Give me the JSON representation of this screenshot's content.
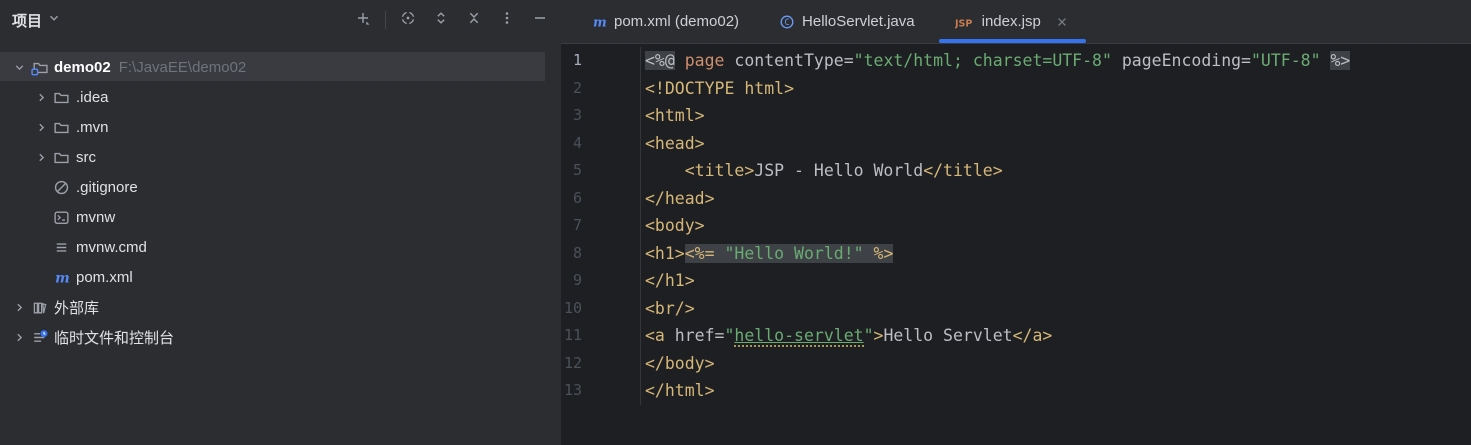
{
  "colors": {
    "accent": "#3574f0",
    "editor_bg": "#1e1f22",
    "panel_bg": "#2b2d30",
    "selection_bg": "#393b40",
    "tag": "#d5b778",
    "keyword": "#cf8e6d",
    "string": "#6aab73",
    "plain_text": "#bcbec4",
    "maven_blue": "#548af7",
    "jsp_orange": "#c77d4f"
  },
  "project_panel": {
    "title": "项目",
    "title_chevron_icon": "chevron-down-icon",
    "toolbar": [
      {
        "id": "add",
        "icon": "plus-icon"
      },
      {
        "id": "divider"
      },
      {
        "id": "locate",
        "icon": "target-icon"
      },
      {
        "id": "expand-all",
        "icon": "expand-icon"
      },
      {
        "id": "collapse-all",
        "icon": "collapse-icon"
      },
      {
        "id": "more",
        "icon": "kebab-icon"
      },
      {
        "id": "hide",
        "icon": "minimize-icon"
      }
    ],
    "tree": [
      {
        "label": "demo02",
        "path": "F:\\JavaEE\\demo02",
        "icon": "project-folder-icon",
        "chevron": "down",
        "level": 0,
        "selected": true,
        "bold": true
      },
      {
        "label": ".idea",
        "icon": "folder-icon",
        "chevron": "right",
        "level": 1
      },
      {
        "label": ".mvn",
        "icon": "folder-icon",
        "chevron": "right",
        "level": 1
      },
      {
        "label": "src",
        "icon": "folder-icon",
        "chevron": "right",
        "level": 1
      },
      {
        "label": ".gitignore",
        "icon": "ignored-file-icon",
        "level": 1
      },
      {
        "label": "mvnw",
        "icon": "shell-file-icon",
        "level": 1
      },
      {
        "label": "mvnw.cmd",
        "icon": "text-file-icon",
        "level": 1
      },
      {
        "label": "pom.xml",
        "icon": "maven-icon",
        "level": 1
      },
      {
        "label": "外部库",
        "icon": "library-icon",
        "chevron": "right",
        "level": 0
      },
      {
        "label": "临时文件和控制台",
        "icon": "scratch-icon",
        "chevron": "right",
        "level": 0
      }
    ]
  },
  "editor": {
    "tabs": [
      {
        "label": "pom.xml (demo02)",
        "icon": "maven-icon",
        "active": false,
        "closable": false
      },
      {
        "label": "HelloServlet.java",
        "icon": "java-class-icon",
        "active": false,
        "closable": false
      },
      {
        "label": "index.jsp",
        "icon": "jsp-icon",
        "active": true,
        "closable": true
      }
    ],
    "close_icon": "close-icon",
    "current_line": 1,
    "code_lines": [
      {
        "num": 1,
        "segments": [
          {
            "c": "caret",
            "t": ""
          },
          {
            "c": "txt jspbg",
            "t": "<%@"
          },
          {
            "c": "txt",
            "t": " "
          },
          {
            "c": "kw",
            "t": "page"
          },
          {
            "c": "txt",
            "t": " contentType="
          },
          {
            "c": "str",
            "t": "\"text/html; charset=UTF-8\""
          },
          {
            "c": "txt",
            "t": " pageEncoding="
          },
          {
            "c": "str",
            "t": "\"UTF-8\""
          },
          {
            "c": "txt",
            "t": " "
          },
          {
            "c": "txt jspbg",
            "t": "%>"
          }
        ]
      },
      {
        "num": 2,
        "segments": [
          {
            "c": "tag",
            "t": "<!DOCTYPE html>"
          }
        ]
      },
      {
        "num": 3,
        "segments": [
          {
            "c": "tag",
            "t": "<html>"
          }
        ]
      },
      {
        "num": 4,
        "segments": [
          {
            "c": "tag",
            "t": "<head>"
          }
        ]
      },
      {
        "num": 5,
        "segments": [
          {
            "c": "txt",
            "t": "    "
          },
          {
            "c": "tag",
            "t": "<title>"
          },
          {
            "c": "txt",
            "t": "JSP - Hello World"
          },
          {
            "c": "tag",
            "t": "</title>"
          }
        ]
      },
      {
        "num": 6,
        "segments": [
          {
            "c": "tag",
            "t": "</head>"
          }
        ]
      },
      {
        "num": 7,
        "segments": [
          {
            "c": "tag",
            "t": "<body>"
          }
        ]
      },
      {
        "num": 8,
        "segments": [
          {
            "c": "tag",
            "t": "<h1>"
          },
          {
            "c": "tag jspbg",
            "t": "<%="
          },
          {
            "c": "txt jspbg",
            "t": " "
          },
          {
            "c": "str jspbg",
            "t": "\"Hello World!\""
          },
          {
            "c": "txt jspbg",
            "t": " "
          },
          {
            "c": "tag jspbg",
            "t": "%>"
          }
        ]
      },
      {
        "num": 9,
        "segments": [
          {
            "c": "tag",
            "t": "</h1>"
          }
        ]
      },
      {
        "num": 10,
        "segments": [
          {
            "c": "tag",
            "t": "<br/>"
          }
        ]
      },
      {
        "num": 11,
        "segments": [
          {
            "c": "tag",
            "t": "<a"
          },
          {
            "c": "txt",
            "t": " href="
          },
          {
            "c": "str",
            "t": "\""
          },
          {
            "c": "str link",
            "t": "hello-servlet",
            "interactable": true,
            "name": "hello-servlet-link"
          },
          {
            "c": "str",
            "t": "\""
          },
          {
            "c": "tag",
            "t": ">"
          },
          {
            "c": "txt",
            "t": "Hello Servlet"
          },
          {
            "c": "tag",
            "t": "</a>"
          }
        ]
      },
      {
        "num": 12,
        "segments": [
          {
            "c": "tag",
            "t": "</body>"
          }
        ]
      },
      {
        "num": 13,
        "segments": [
          {
            "c": "tag",
            "t": "</html>"
          }
        ]
      }
    ]
  }
}
